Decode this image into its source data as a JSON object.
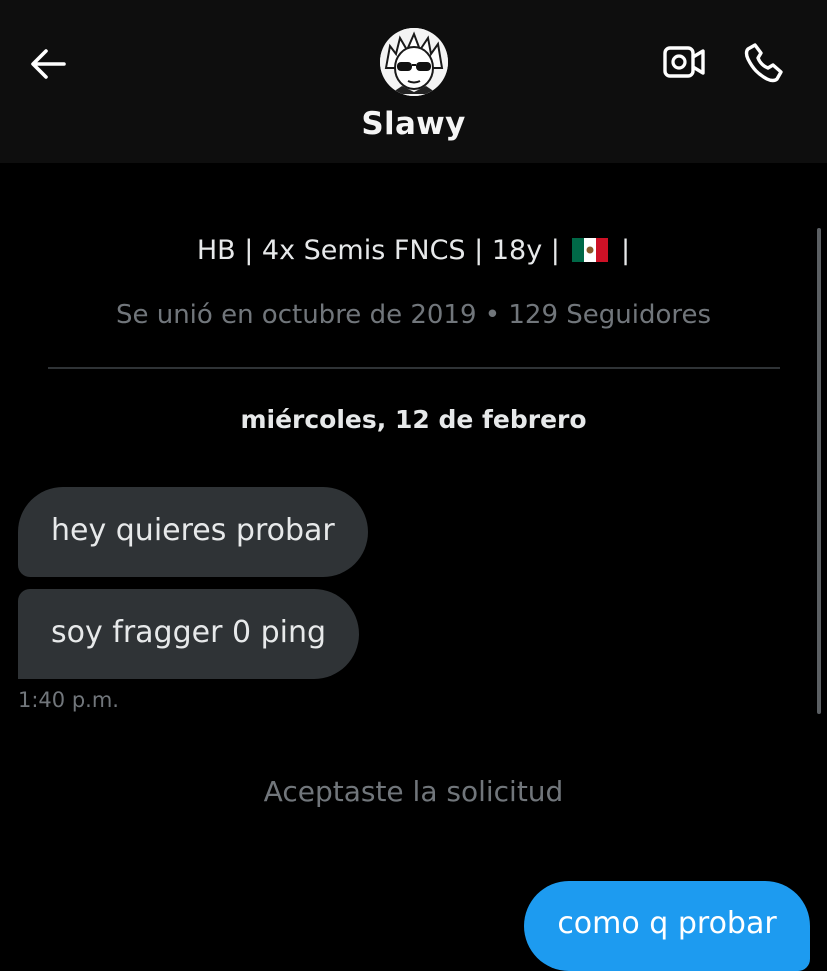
{
  "header": {
    "title": "Slawy",
    "back_icon": "arrow-left-icon",
    "video_icon": "video-camera-icon",
    "call_icon": "phone-icon"
  },
  "profile": {
    "bio_prefix": "HB | 4x Semis FNCS | 18y |",
    "bio_suffix": "|",
    "flag_icon": "mexico-flag-icon",
    "joined": "Se unió en octubre de 2019 • 129 Seguidores"
  },
  "conversation": {
    "date_separator": "miércoles, 12 de febrero",
    "incoming_messages": [
      "hey quieres probar",
      "soy fragger 0 ping"
    ],
    "incoming_time": "1:40 p.m.",
    "status_text": "Aceptaste la solicitud",
    "outgoing_messages": [
      "como q probar"
    ]
  },
  "colors": {
    "background": "#000000",
    "header_bg": "#0e0e0e",
    "incoming_bubble": "#2f3336",
    "outgoing_bubble": "#1d9bf0",
    "muted_text": "#71767b"
  }
}
